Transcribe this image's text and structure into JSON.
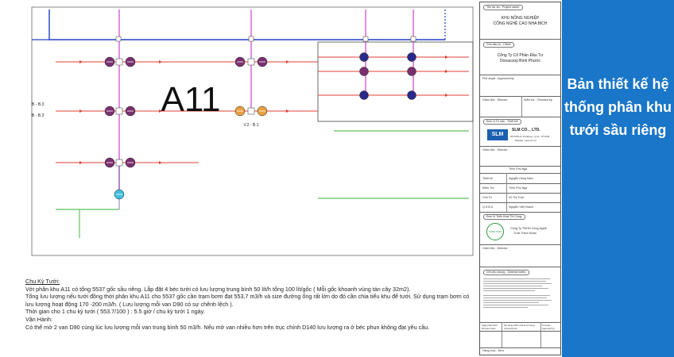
{
  "diagram": {
    "zone_label": "A11",
    "valve_label": "V.2 - B.1",
    "left_label_1": "B - B.3",
    "left_label_2": "B - B.3"
  },
  "notes": {
    "title": "Chu Kỳ Tưới:",
    "p1": "Với phân khu A11 có tổng 5537 gốc sầu riêng. Lắp đặt 4 béc tưới có lưu lượng trung bình 50 lít/h tổng 100 lít/gốc ( Mỗi gốc khoanh vùng tán cây 32m2).",
    "p2": "Tổng lưu lượng nếu tưới đồng thời phân khu A11 cho 5537 gốc cần trạm bơm đạt 553,7 m3/h và size đường ống rất lớn do đó cần chia tiểu khu để tưới. Sử dụng trạm bơm có lưu lượng hoạt động 170 -200 m3/h. ( Lưu lượng mỗi van D90 có sự chênh lệch ).",
    "p3": "Thời gian cho 1 chu kỳ tưới ( 553.7/100 ) : 5.5 giờ / chu kỳ tưới 1 ngày.",
    "title2": "Vận Hành:",
    "p4": "Có thể mở 2 van D90 cùng lúc lưu lượng mỗi van trung bình 50 m3/h. Nếu mở van nhiều hơn trên trục chính D140 lưu lượng ra ở béc phun không đạt yêu cầu."
  },
  "titleblock": {
    "project_label": "Tên dự án - Project name:",
    "project_name_1": "KHU NÔNG NGHIỆP",
    "project_name_2": "CÔNG NGHỆ CAO NHA BÍCH",
    "client_label": "Chủ đầu tư - Client:",
    "client_1": "Công Ty Cổ Phần Đầu Tư",
    "client_2": "Donacoop Bình Phước",
    "approved_label": "Phê duyệt - Approved by:",
    "director_label": "Giám đốc - Director:",
    "checked_label": "Kiểm tra - Checked by:",
    "design_label": "Đơn vị Tư vấn - Thiết Kế:",
    "company_logo": "SLM",
    "company_name": "SLM CO. , LTD.",
    "company_addr": "367/3/15 An phú Đông - Q.12 - TP.HCM",
    "company_web": "Website : www.slm.vn",
    "director_label_2": "Giám đốc - Director:",
    "roles": [
      "Trình Phú Nga",
      "Thiết kế",
      "Nguyễn Hồng Nam",
      "Kiểm Tra",
      "Trình Phú Nga",
      "Chủ Trì",
      "Vũ Thị Tươi",
      "Q.H.Đ.A",
      "Nguyễn Viết Khánh"
    ],
    "contractor_label": "Đơn Vị Triển Khai Thi Công:",
    "contractor_1": "Công Ty TNHH Công Nghệ",
    "contractor_2": "Tưới Thịnh Nhân",
    "contractor_logo": "THINH NHAN",
    "director_label_3": "Giám đốc - Director:",
    "notes_label": "Ghi chú chung - General notes:",
    "bottom_cols": [
      "Ngày phát hành Revision Date",
      "Nội dung chỉnh sửa & nội dung Amendments",
      "Kí duyệt Approved by"
    ],
    "sheet_label": "Hạng mục - Item:"
  },
  "banner": {
    "text": "Bản thiết kế hệ thống phân khu tưới sầu riêng"
  },
  "colors": {
    "banner": "#1976c8",
    "pipe_blue": "#2040c8",
    "pipe_magenta": "#d040c8",
    "pipe_red": "#e04030",
    "pipe_green": "#30b030",
    "valve_purple": "#7a3070",
    "valve_navy": "#2a2a8a",
    "valve_orange": "#e8a040"
  }
}
